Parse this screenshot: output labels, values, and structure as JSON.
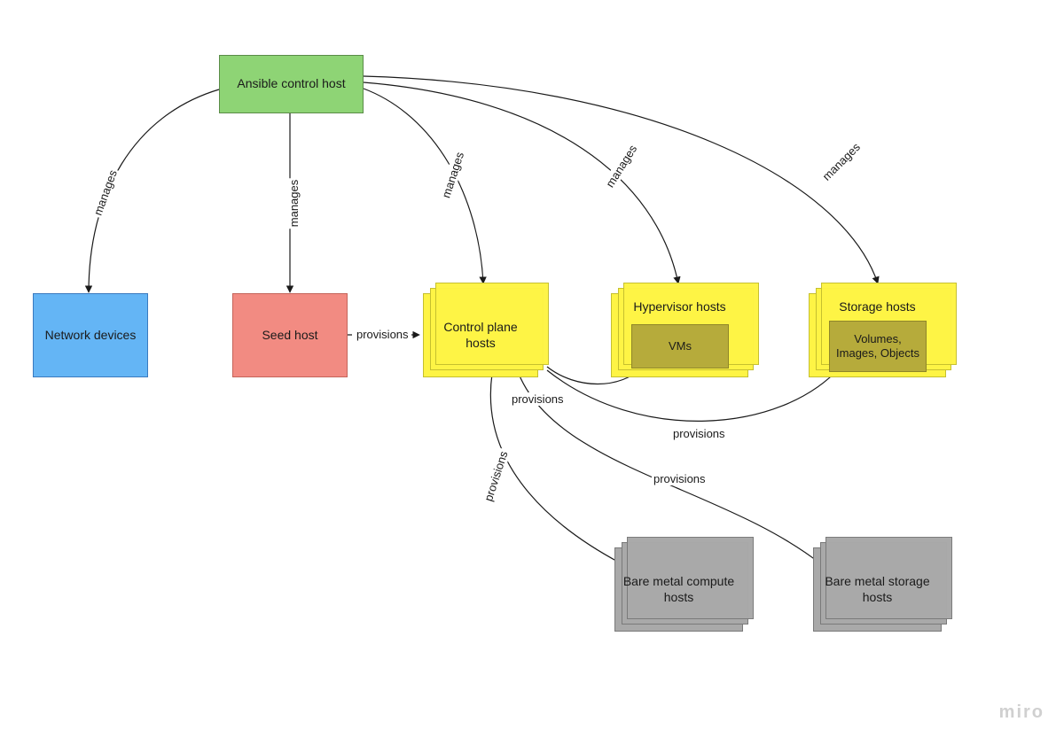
{
  "nodes": {
    "ansible": {
      "label": "Ansible control host"
    },
    "network": {
      "label": "Network devices"
    },
    "seed": {
      "label": "Seed host"
    },
    "control_plane": {
      "label": "Control plane hosts"
    },
    "hypervisor": {
      "title": "Hypervisor hosts",
      "inner": "VMs"
    },
    "storage": {
      "title": "Storage hosts",
      "inner": "Volumes, Images, Objects"
    },
    "bm_compute": {
      "label": "Bare metal compute hosts"
    },
    "bm_storage": {
      "label": "Bare metal storage hosts"
    }
  },
  "edges": {
    "manages_network": "manages",
    "manages_seed": "manages",
    "manages_control": "manages",
    "manages_hypervisor": "manages",
    "manages_storage": "manages",
    "seed_provisions_control": "provisions",
    "control_prov_vms": "provisions",
    "control_prov_volumes": "provisions",
    "control_prov_bm_compute": "provisions",
    "control_prov_bm_storage": "provisions"
  },
  "branding": {
    "logo": "miro"
  }
}
